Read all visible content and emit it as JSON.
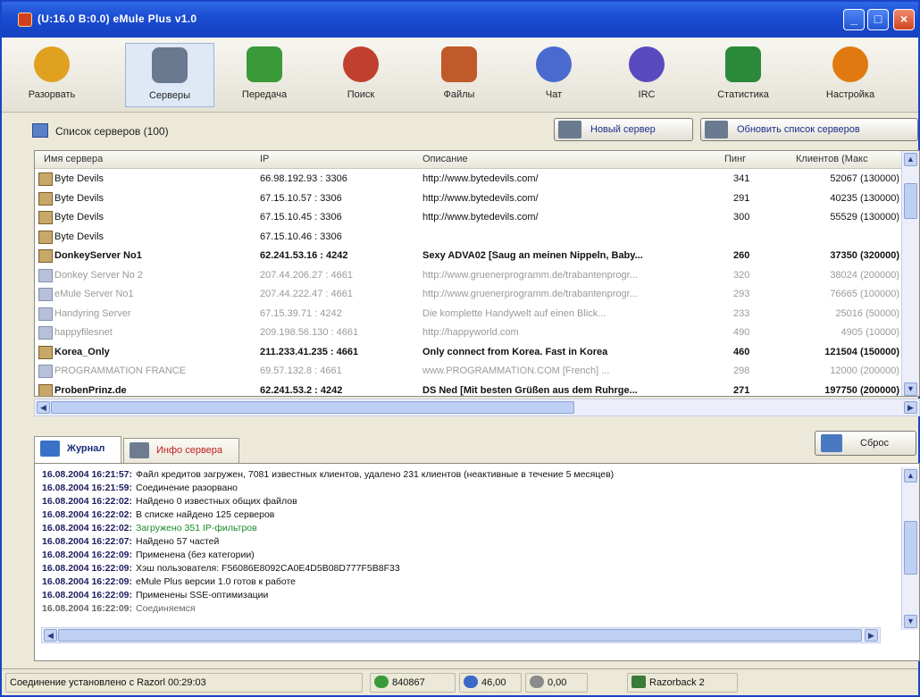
{
  "window": {
    "title": "(U:16.0 B:0.0) eMule Plus v1.0"
  },
  "toolbar": {
    "items": [
      {
        "label": "Разорвать",
        "icon": "disconnect-icon",
        "color": "#e0a020"
      },
      {
        "label": "Серверы",
        "icon": "servers-icon",
        "color": "#6a7890"
      },
      {
        "label": "Передача",
        "icon": "transfer-icon",
        "color": "#3a9a3a"
      },
      {
        "label": "Поиск",
        "icon": "search-icon",
        "color": "#c04030"
      },
      {
        "label": "Файлы",
        "icon": "files-icon",
        "color": "#c05a2a"
      },
      {
        "label": "Чат",
        "icon": "chat-icon",
        "color": "#4a6ad0"
      },
      {
        "label": "IRC",
        "icon": "irc-icon",
        "color": "#5a4ac0"
      },
      {
        "label": "Статистика",
        "icon": "statistics-icon",
        "color": "#2a8a3a"
      },
      {
        "label": "Настройка",
        "icon": "settings-icon",
        "color": "#e07a10"
      }
    ]
  },
  "server_list": {
    "title": "Список серверов (100)",
    "new_server_label": "Новый сервер",
    "update_list_label": "Обновить список серверов",
    "columns": [
      "Имя сервера",
      "IP",
      "Описание",
      "Пинг",
      "Клиентов (Макс"
    ],
    "rows": [
      {
        "name": "Byte Devils",
        "ip": "66.98.192.93 : 3306",
        "desc": "http://www.bytedevils.com/",
        "ping": "341",
        "users": "52067 (130000)",
        "style": "normal"
      },
      {
        "name": "Byte Devils",
        "ip": "67.15.10.57 : 3306",
        "desc": "http://www.bytedevils.com/",
        "ping": "291",
        "users": "40235 (130000)",
        "style": "normal"
      },
      {
        "name": "Byte Devils",
        "ip": "67.15.10.45 : 3306",
        "desc": "http://www.bytedevils.com/",
        "ping": "300",
        "users": "55529 (130000)",
        "style": "normal"
      },
      {
        "name": "Byte Devils",
        "ip": "67.15.10.46 : 3306",
        "desc": "",
        "ping": "",
        "users": "",
        "style": "normal"
      },
      {
        "name": "DonkeyServer No1",
        "ip": "62.241.53.16 : 4242",
        "desc": "Sexy ADVA02 [Saug an meinen Nippeln, Baby...",
        "ping": "260",
        "users": "37350 (320000)",
        "style": "bold"
      },
      {
        "name": "Donkey Server No 2",
        "ip": "207.44.206.27 : 4661",
        "desc": "http://www.gruenerprogramm.de/trabantenprogr...",
        "ping": "320",
        "users": "38024 (200000)",
        "style": "faded"
      },
      {
        "name": "eMule Server No1",
        "ip": "207.44.222.47 : 4661",
        "desc": "http://www.gruenerprogramm.de/trabantenprogr...",
        "ping": "293",
        "users": "76665 (100000)",
        "style": "faded"
      },
      {
        "name": "Handyring Server",
        "ip": "67.15.39.71 : 4242",
        "desc": "Die komplette Handywelt auf einen Blick...",
        "ping": "233",
        "users": "25016 (50000)",
        "style": "faded"
      },
      {
        "name": "happyfilesnet",
        "ip": "209.198.56.130 : 4661",
        "desc": "http://happyworld.com",
        "ping": "490",
        "users": "4905 (10000)",
        "style": "faded"
      },
      {
        "name": "Korea_Only",
        "ip": "211.233.41.235 : 4661",
        "desc": "Only connect from Korea. Fast in Korea",
        "ping": "460",
        "users": "121504 (150000)",
        "style": "bold"
      },
      {
        "name": "PROGRAMMATION FRANCE",
        "ip": "69.57.132.8 : 4661",
        "desc": "www.PROGRAMMATION.COM [French] ...",
        "ping": "298",
        "users": "12000 (200000)",
        "style": "faded"
      },
      {
        "name": "ProbenPrinz.de",
        "ip": "62.241.53.2 : 4242",
        "desc": "DS Ned [Mit besten Grüßen aus dem Ruhrge...",
        "ping": "271",
        "users": "197750 (200000)",
        "style": "bold"
      }
    ]
  },
  "tabs": {
    "journal_label": "Журнал",
    "server_info_label": "Инфо сервера",
    "reset_label": "Сброс"
  },
  "log": [
    {
      "ts": "16.08.2004 16:21:57:",
      "msg": "Файл кредитов загружен, 7081 известных клиентов, удалено 231 клиентов (неактивные в течение 5 месяцев)",
      "style": "normal"
    },
    {
      "ts": "16.08.2004 16:21:59:",
      "msg": "Соединение разорвано",
      "style": "normal"
    },
    {
      "ts": "16.08.2004 16:22:02:",
      "msg": "Найдено 0 известных общих файлов",
      "style": "normal"
    },
    {
      "ts": "16.08.2004 16:22:02:",
      "msg": "В списке найдено 125 серверов",
      "style": "normal"
    },
    {
      "ts": "16.08.2004 16:22:02:",
      "msg": "Загружено 351 IP-фильтров",
      "style": "green"
    },
    {
      "ts": "16.08.2004 16:22:07:",
      "msg": "Найдено 57 частей",
      "style": "normal"
    },
    {
      "ts": "16.08.2004 16:22:09:",
      "msg": "Применена (без категории)",
      "style": "normal"
    },
    {
      "ts": "16.08.2004 16:22:09:",
      "msg": "Хэш пользователя: F56086E8092CA0E4D5B08D777F5B8F33",
      "style": "normal"
    },
    {
      "ts": "16.08.2004 16:22:09:",
      "msg": "eMule Plus версии 1.0 готов к работе",
      "style": "normal"
    },
    {
      "ts": "16.08.2004 16:22:09:",
      "msg": "Применены SSE-оптимизации",
      "style": "normal"
    },
    {
      "ts": "16.08.2004 16:22:09:",
      "msg": "Соединяемся",
      "style": "faded"
    }
  ],
  "status": {
    "connection": "Соединение установлено с Razorl 00:29:03",
    "users": "840867",
    "upload": "46,00",
    "download": "0,00",
    "server": "Razorback 2"
  }
}
